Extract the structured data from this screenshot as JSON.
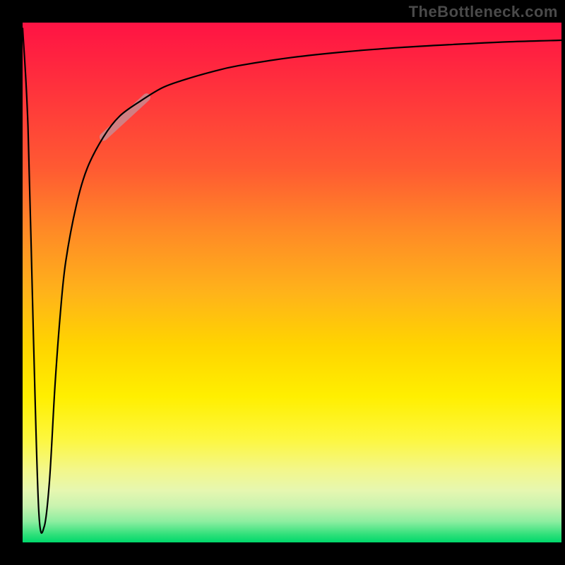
{
  "watermark": "TheBottleneck.com",
  "colors": {
    "frame": "#000000",
    "curve": "#000000",
    "highlight": "#c98a8f",
    "gradient_top": "#ff1344",
    "gradient_bottom": "#00d86b"
  },
  "chart_data": {
    "type": "line",
    "title": "",
    "xlabel": "",
    "ylabel": "",
    "xlim": [
      0,
      100
    ],
    "ylim": [
      0,
      100
    ],
    "grid": false,
    "legend": false,
    "x": [
      0,
      1,
      2,
      3,
      4,
      5,
      6,
      7,
      8,
      10,
      12,
      15,
      18,
      22,
      26,
      30,
      35,
      40,
      50,
      60,
      70,
      80,
      90,
      100
    ],
    "values": [
      99,
      80,
      40,
      6,
      3,
      12,
      30,
      44,
      54,
      65,
      72,
      78,
      82,
      85,
      87.5,
      89,
      90.5,
      91.7,
      93.3,
      94.4,
      95.2,
      95.8,
      96.3,
      96.6
    ],
    "note": "Values are % heights read off the vertical color gradient (0 = bottom/green, 100 = top/red). Curve plunges from top-left to a narrow trough near x≈4%, then rises asymptotically toward the top-right.",
    "highlight_segment": {
      "x_start": 15,
      "x_end": 23
    }
  }
}
